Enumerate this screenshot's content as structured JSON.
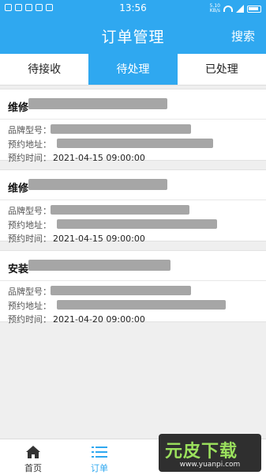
{
  "status_bar": {
    "time": "13:56",
    "network_text": "5.10\nKB/s"
  },
  "header": {
    "title": "订单管理",
    "search_label": "搜索"
  },
  "tabs": [
    {
      "label": "待接收",
      "active": false
    },
    {
      "label": "待处理",
      "active": true
    },
    {
      "label": "已处理",
      "active": false
    }
  ],
  "orders": [
    {
      "type": "维修",
      "brand_label": "品牌型号：",
      "address_label": "预约地址：",
      "time_label": "预约时间：",
      "time_value": "2021-04-15 09:00:00"
    },
    {
      "type": "维修",
      "brand_label": "品牌型号：",
      "address_label": "预约地址：",
      "time_label": "预约时间：",
      "time_value": "2021-04-15 09:00:00"
    },
    {
      "type": "安装",
      "brand_label": "品牌型号：",
      "address_label": "预约地址：",
      "time_label": "预约时间：",
      "time_value": "2021-04-20 09:00:00"
    }
  ],
  "bottom_nav": [
    {
      "label": "首页",
      "icon": "home-icon",
      "active": false
    },
    {
      "label": "订单",
      "icon": "list-icon",
      "active": true
    }
  ],
  "watermark": {
    "title": "元皮下载",
    "url": "www.yuanpi.com"
  },
  "colors": {
    "accent": "#2fa8f0",
    "background": "#efefef"
  }
}
